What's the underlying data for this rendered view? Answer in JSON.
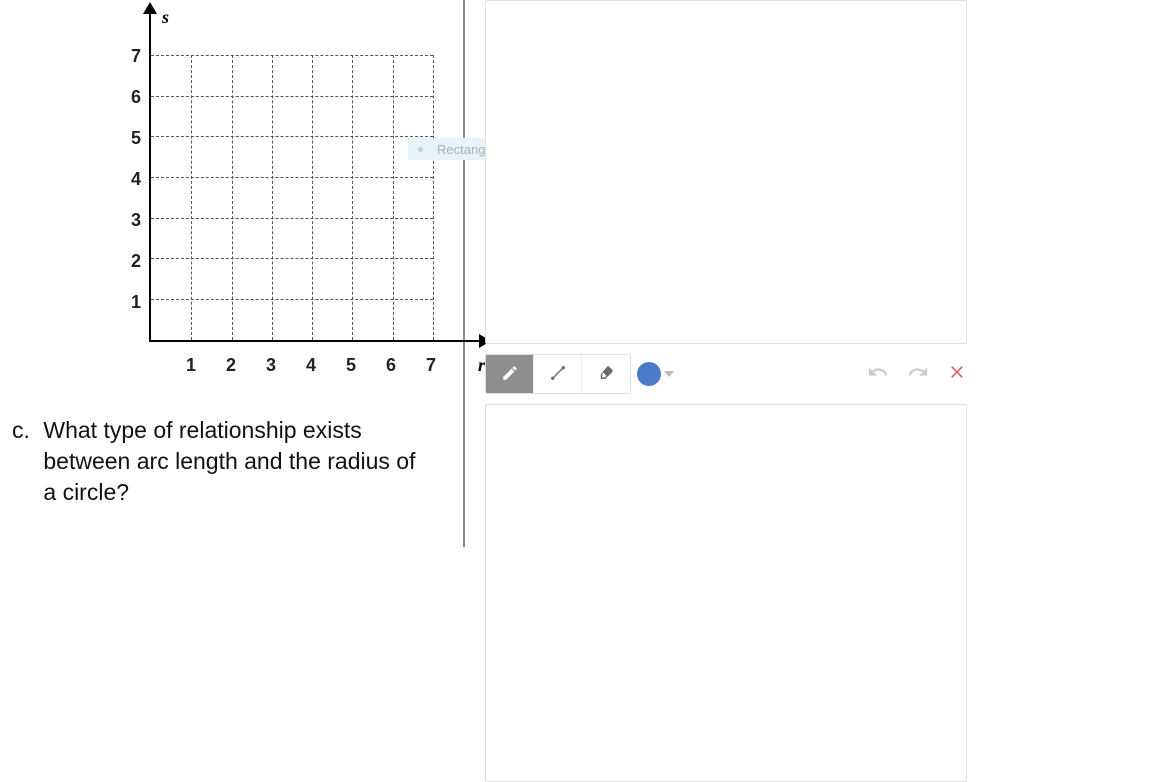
{
  "chart_data": {
    "type": "scatter",
    "title": "",
    "x": [],
    "y": [],
    "xlabel": "r",
    "ylabel": "s",
    "x_ticks": [
      "1",
      "2",
      "3",
      "4",
      "5",
      "6",
      "7"
    ],
    "y_ticks": [
      "1",
      "2",
      "3",
      "4",
      "5",
      "6",
      "7"
    ],
    "xlim": [
      0,
      7
    ],
    "ylim": [
      0,
      7
    ],
    "grid": true
  },
  "question": {
    "label": "c.",
    "text": "What type of relationship exists between arc length and the radius of a circle?"
  },
  "snip": {
    "label": "Rectangular Snip"
  },
  "toolbar": {
    "pen": "pen",
    "line": "line",
    "eraser": "eraser",
    "color": "#4a7bc8",
    "undo": "undo",
    "redo": "redo",
    "close": "close"
  }
}
